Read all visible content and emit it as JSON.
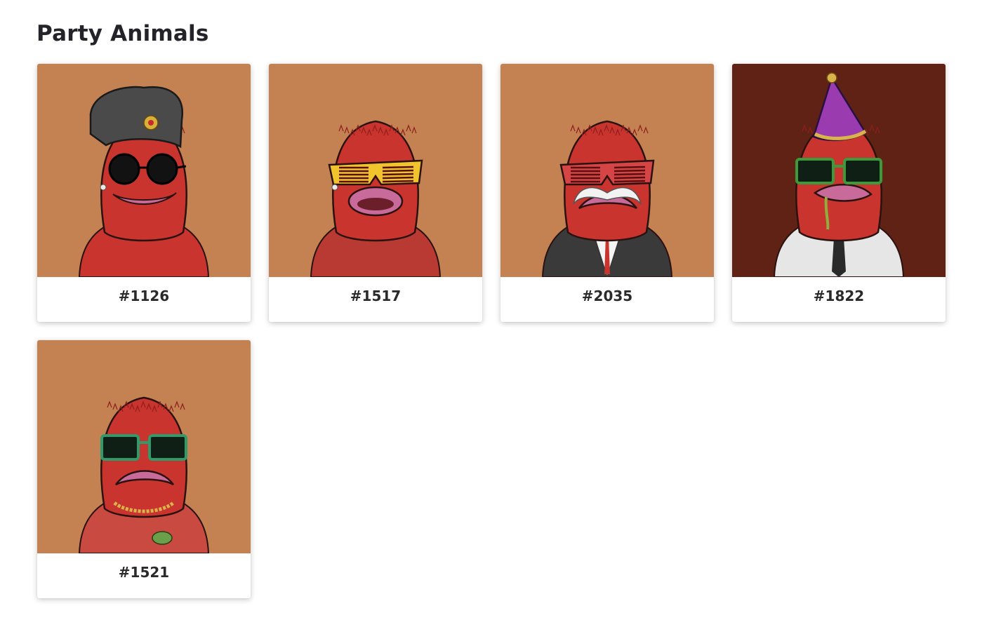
{
  "collection": {
    "title": "Party Animals"
  },
  "items": [
    {
      "label": "#1126",
      "background": "#c48253",
      "hat": "ushanka",
      "eyewear": "round-black-sunglasses",
      "eyewear_color": "#1a1a1a",
      "mouth": "smile",
      "outfit": "fur",
      "accessory": "earring"
    },
    {
      "label": "#1517",
      "background": "#c48253",
      "hat": "none",
      "eyewear": "shutter-shades",
      "eyewear_color": "#f1c32c",
      "mouth": "open",
      "outfit": "red-shirt",
      "accessory": "earring"
    },
    {
      "label": "#2035",
      "background": "#c48253",
      "hat": "none",
      "eyewear": "shutter-shades",
      "eyewear_color": "#d64545",
      "mouth": "frown",
      "outfit": "black-suit",
      "accessory": "white-mustache"
    },
    {
      "label": "#1822",
      "background": "#5f2214",
      "hat": "party-hat",
      "eyewear": "square-sunglasses",
      "eyewear_color": "#3c9a3a",
      "mouth": "drool",
      "outfit": "white-shirt-tie",
      "accessory": "none"
    },
    {
      "label": "#1521",
      "background": "#c48253",
      "hat": "none",
      "eyewear": "square-sunglasses",
      "eyewear_color": "#2f9a6a",
      "mouth": "frown",
      "outfit": "red-sweater",
      "accessory": "gold-chain-pepe"
    }
  ]
}
